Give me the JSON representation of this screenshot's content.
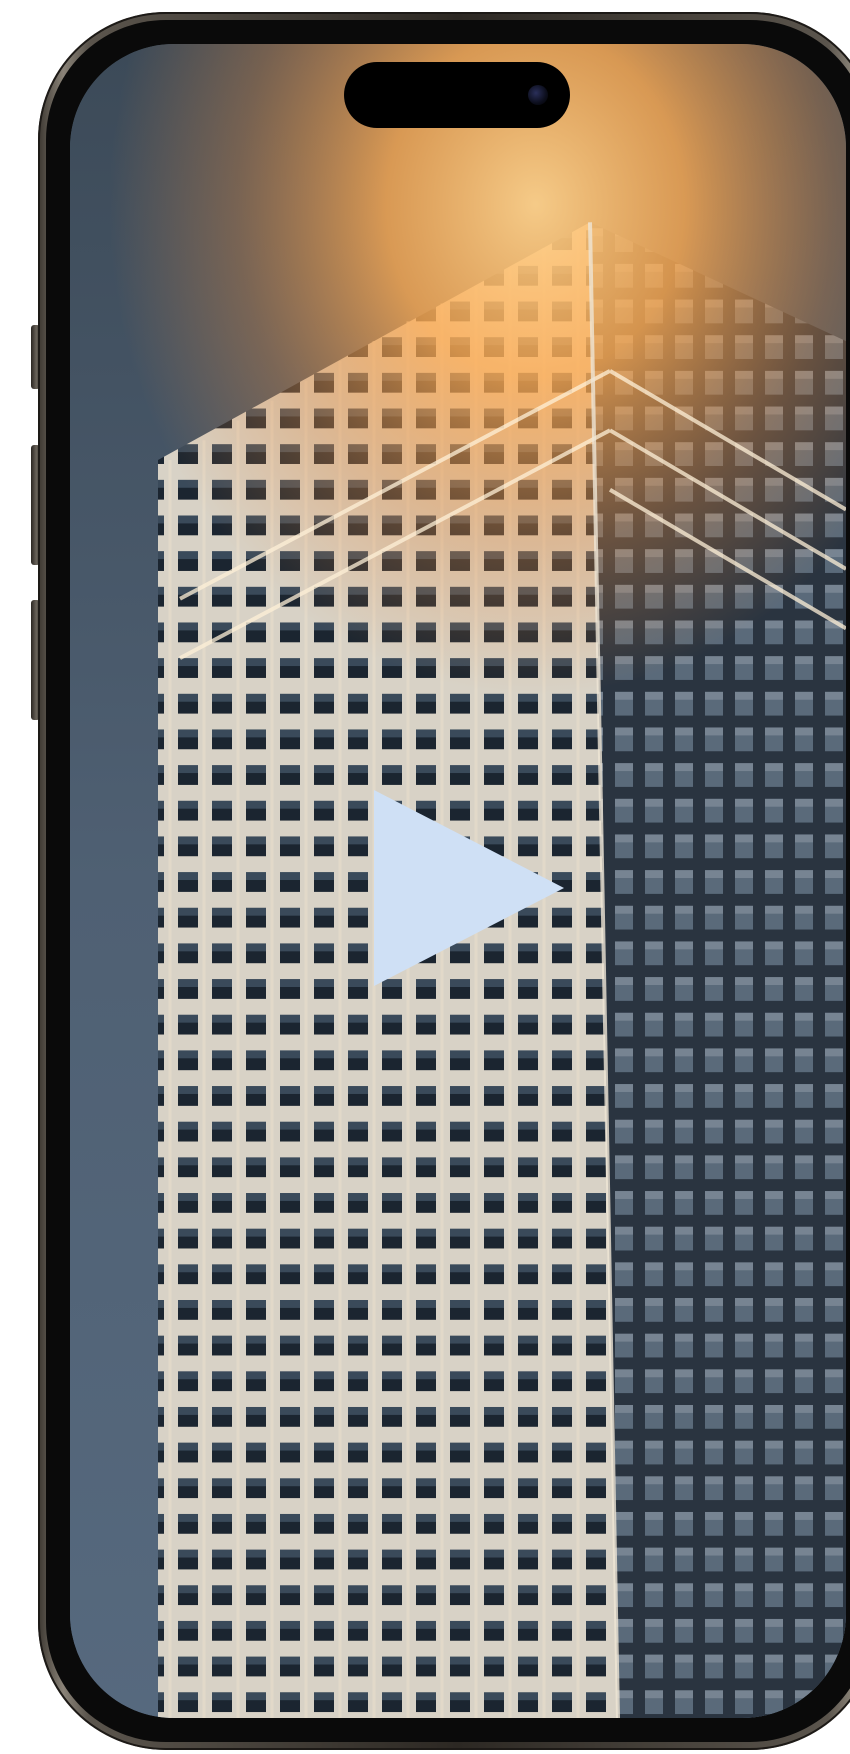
{
  "video": {
    "accessible_label": "",
    "state": "paused"
  },
  "icons": {
    "play": "play-icon"
  },
  "colors": {
    "sky_top": "#3f4e5c",
    "sky_bottom": "#55677a",
    "glow": "#ffb25a",
    "play_fill": "#cfe0f5",
    "frame": "#3b3630"
  }
}
